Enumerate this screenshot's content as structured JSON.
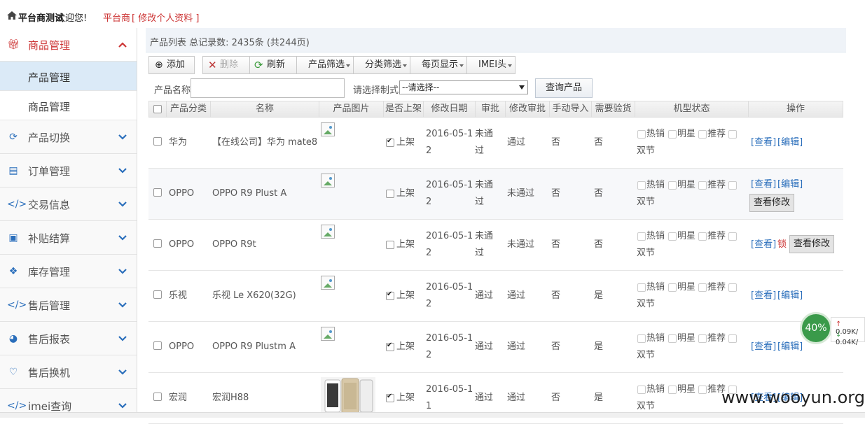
{
  "topbar": {
    "brand": "平台商测试",
    "welcome": "欢迎您!",
    "role": "平台商",
    "edit_profile": "[ 修改个人资料 ]"
  },
  "sidebar": {
    "items": [
      {
        "label": "商品管理",
        "icon": "gift-icon",
        "open": true
      },
      {
        "label": "产品管理",
        "sub": true,
        "active": true
      },
      {
        "label": "商品管理",
        "sub": true
      },
      {
        "label": "产品切换",
        "icon": "refresh-icon"
      },
      {
        "label": "订单管理",
        "icon": "document-icon"
      },
      {
        "label": "交易信息",
        "icon": "code-icon"
      },
      {
        "label": "补贴结算",
        "icon": "money-icon"
      },
      {
        "label": "库存管理",
        "icon": "cubes-icon"
      },
      {
        "label": "售后管理",
        "icon": "code-icon"
      },
      {
        "label": "售后报表",
        "icon": "pie-chart-icon"
      },
      {
        "label": "售后换机",
        "icon": "heart-icon"
      },
      {
        "label": "imei查询",
        "icon": "code-icon"
      }
    ]
  },
  "breadcrumb": "产品列表  总记录数: 2435条 (共244页)",
  "toolbar": {
    "add": "添加",
    "delete": "删除",
    "refresh": "刷新",
    "filter_product": "产品筛选",
    "filter_category": "分类筛选",
    "per_page": "每页显示",
    "imei_head": "IMEI头"
  },
  "search": {
    "name_label": "产品名称",
    "name_value": "",
    "system_label": "请选择制式",
    "system_value": "--请选择--",
    "query_button": "查询产品"
  },
  "table": {
    "headers": [
      "产品分类",
      "名称",
      "产品图片",
      "是否上架",
      "修改日期",
      "审批",
      "修改审批",
      "手动导入",
      "需要验货",
      "机型状态",
      "操作"
    ],
    "shelf_label": "上架",
    "status_tags": [
      "热销",
      "明星",
      "推荐",
      "双节"
    ],
    "rows": [
      {
        "category": "华为",
        "name": "【在线公司】华为 mate8",
        "on_shelf": true,
        "date1": "2016-05-1",
        "date2": "2",
        "approval1": "未通",
        "approval2": "过",
        "mod_approval": "通过",
        "manual_import": "否",
        "need_inspect": "否",
        "ops": [
          "[查看]",
          "[编辑]"
        ]
      },
      {
        "category": "OPPO",
        "name": "OPPO R9 Plust A",
        "on_shelf": false,
        "date1": "2016-05-1",
        "date2": "2",
        "approval1": "未通",
        "approval2": "过",
        "mod_approval": "未通过",
        "manual_import": "否",
        "need_inspect": "否",
        "ops": [
          "[查看]",
          "[编辑]"
        ],
        "extra_button": "查看修改"
      },
      {
        "category": "OPPO",
        "name": "OPPO R9t",
        "on_shelf": false,
        "date1": "2016-05-1",
        "date2": "2",
        "approval1": "未通",
        "approval2": "过",
        "mod_approval": "未通过",
        "manual_import": "否",
        "need_inspect": "否",
        "ops": [
          "[查看]"
        ],
        "lock": "锁",
        "extra_button": "查看修改"
      },
      {
        "category": "乐视",
        "name": "乐视 Le X620(32G)",
        "on_shelf": true,
        "date1": "2016-05-1",
        "date2": "2",
        "approval1": "通过",
        "approval2": "",
        "mod_approval": "通过",
        "manual_import": "否",
        "need_inspect": "是",
        "ops": [
          "[查看]",
          "[编辑]"
        ]
      },
      {
        "category": "OPPO",
        "name": "OPPO R9 Plustm A",
        "on_shelf": true,
        "date1": "2016-05-1",
        "date2": "2",
        "approval1": "通过",
        "approval2": "",
        "mod_approval": "通过",
        "manual_import": "否",
        "need_inspect": "是",
        "ops": [
          "[查看]",
          "[编辑]"
        ]
      },
      {
        "category": "宏润",
        "name": "宏润H88",
        "on_shelf": true,
        "date1": "2016-05-1",
        "date2": "1",
        "approval1": "通过",
        "approval2": "",
        "mod_approval": "通过",
        "manual_import": "否",
        "need_inspect": "是",
        "ops": [
          "[查看]",
          "[编辑]"
        ]
      }
    ]
  },
  "netwidget": {
    "percent": "40%",
    "up": "0.09K/",
    "down": "0.04K/"
  },
  "watermark": "www.wooyun.org",
  "colors": {
    "accent_red": "#c33",
    "link_blue": "#2a6ebb",
    "active_sub": "#dbeaf7"
  }
}
